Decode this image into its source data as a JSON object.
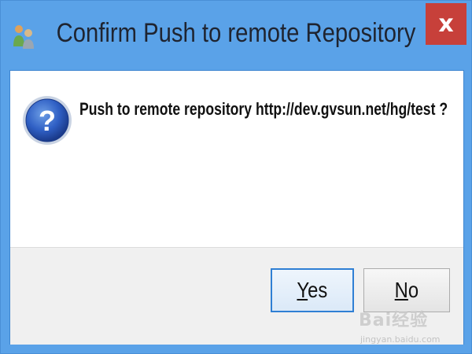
{
  "window": {
    "title": "Confirm Push to remote Repository",
    "close_label": "x",
    "icon": "users-icon"
  },
  "dialog": {
    "icon": "question-icon",
    "message": "Push to remote repository http://dev.gvsun.net/hg/test ?"
  },
  "buttons": {
    "yes_mnemonic": "Y",
    "yes_rest": "es",
    "no_mnemonic": "N",
    "no_rest": "o"
  },
  "watermark": {
    "logo": "Bai经验",
    "url": "jingyan.baidu.com"
  },
  "colors": {
    "title_bar": "#5aa2e8",
    "close_button": "#c7403a",
    "default_button_border": "#2f7fd4",
    "footer": "#f0f0f0"
  }
}
